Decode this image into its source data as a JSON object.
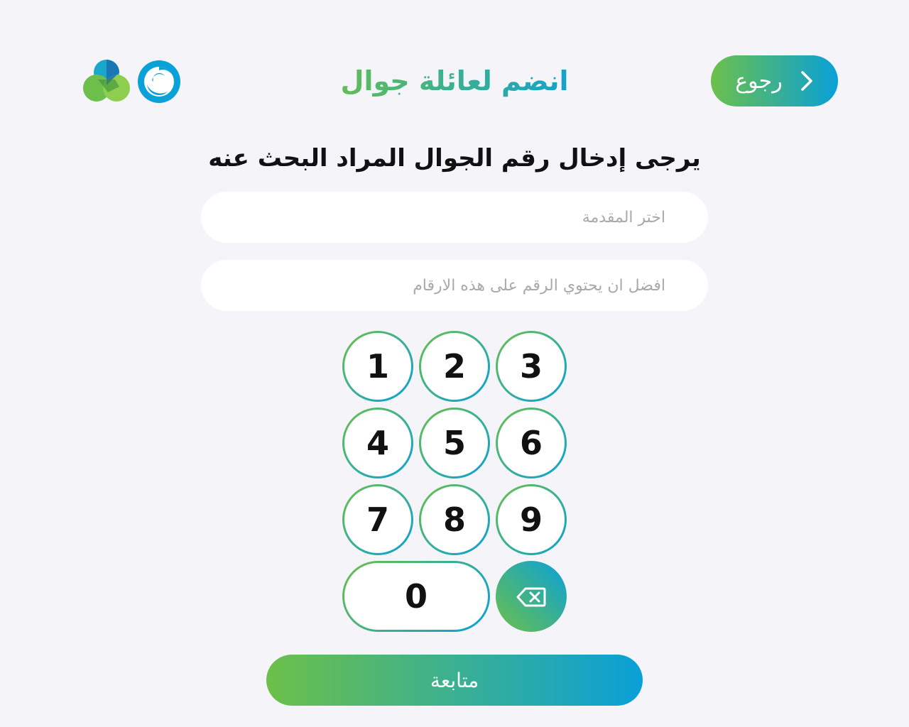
{
  "header": {
    "title": "انضم لعائلة جوال",
    "back_label": "رجوع",
    "logos": [
      "clover-logo",
      "swirl-logo"
    ]
  },
  "instruction": "يرجى إدخال رقم الجوال المراد البحث عنه",
  "fields": {
    "prefix": {
      "value": "",
      "placeholder": "اختر المقدمة"
    },
    "number": {
      "value": "",
      "placeholder": "افضل ان يحتوي الرقم على هذه الارقام"
    }
  },
  "keypad": {
    "keys": [
      "1",
      "2",
      "3",
      "4",
      "5",
      "6",
      "7",
      "8",
      "9",
      "0"
    ],
    "backspace_icon": "backspace-icon"
  },
  "continue_label": "متابعة",
  "colors": {
    "gradient_start": "#6cc04a",
    "gradient_end": "#0aa0d8",
    "background": "#f5f5f9"
  }
}
